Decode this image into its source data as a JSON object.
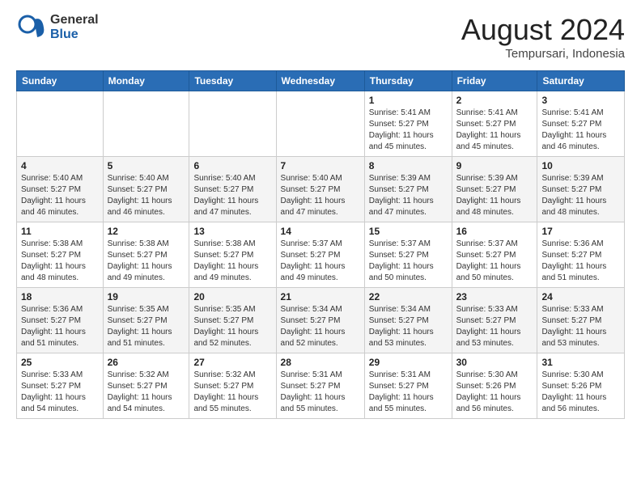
{
  "header": {
    "logo_general": "General",
    "logo_blue": "Blue",
    "month_title": "August 2024",
    "location": "Tempursari, Indonesia"
  },
  "days_of_week": [
    "Sunday",
    "Monday",
    "Tuesday",
    "Wednesday",
    "Thursday",
    "Friday",
    "Saturday"
  ],
  "weeks": [
    [
      {
        "day": "",
        "info": ""
      },
      {
        "day": "",
        "info": ""
      },
      {
        "day": "",
        "info": ""
      },
      {
        "day": "",
        "info": ""
      },
      {
        "day": "1",
        "info": "Sunrise: 5:41 AM\nSunset: 5:27 PM\nDaylight: 11 hours\nand 45 minutes."
      },
      {
        "day": "2",
        "info": "Sunrise: 5:41 AM\nSunset: 5:27 PM\nDaylight: 11 hours\nand 45 minutes."
      },
      {
        "day": "3",
        "info": "Sunrise: 5:41 AM\nSunset: 5:27 PM\nDaylight: 11 hours\nand 46 minutes."
      }
    ],
    [
      {
        "day": "4",
        "info": "Sunrise: 5:40 AM\nSunset: 5:27 PM\nDaylight: 11 hours\nand 46 minutes."
      },
      {
        "day": "5",
        "info": "Sunrise: 5:40 AM\nSunset: 5:27 PM\nDaylight: 11 hours\nand 46 minutes."
      },
      {
        "day": "6",
        "info": "Sunrise: 5:40 AM\nSunset: 5:27 PM\nDaylight: 11 hours\nand 47 minutes."
      },
      {
        "day": "7",
        "info": "Sunrise: 5:40 AM\nSunset: 5:27 PM\nDaylight: 11 hours\nand 47 minutes."
      },
      {
        "day": "8",
        "info": "Sunrise: 5:39 AM\nSunset: 5:27 PM\nDaylight: 11 hours\nand 47 minutes."
      },
      {
        "day": "9",
        "info": "Sunrise: 5:39 AM\nSunset: 5:27 PM\nDaylight: 11 hours\nand 48 minutes."
      },
      {
        "day": "10",
        "info": "Sunrise: 5:39 AM\nSunset: 5:27 PM\nDaylight: 11 hours\nand 48 minutes."
      }
    ],
    [
      {
        "day": "11",
        "info": "Sunrise: 5:38 AM\nSunset: 5:27 PM\nDaylight: 11 hours\nand 48 minutes."
      },
      {
        "day": "12",
        "info": "Sunrise: 5:38 AM\nSunset: 5:27 PM\nDaylight: 11 hours\nand 49 minutes."
      },
      {
        "day": "13",
        "info": "Sunrise: 5:38 AM\nSunset: 5:27 PM\nDaylight: 11 hours\nand 49 minutes."
      },
      {
        "day": "14",
        "info": "Sunrise: 5:37 AM\nSunset: 5:27 PM\nDaylight: 11 hours\nand 49 minutes."
      },
      {
        "day": "15",
        "info": "Sunrise: 5:37 AM\nSunset: 5:27 PM\nDaylight: 11 hours\nand 50 minutes."
      },
      {
        "day": "16",
        "info": "Sunrise: 5:37 AM\nSunset: 5:27 PM\nDaylight: 11 hours\nand 50 minutes."
      },
      {
        "day": "17",
        "info": "Sunrise: 5:36 AM\nSunset: 5:27 PM\nDaylight: 11 hours\nand 51 minutes."
      }
    ],
    [
      {
        "day": "18",
        "info": "Sunrise: 5:36 AM\nSunset: 5:27 PM\nDaylight: 11 hours\nand 51 minutes."
      },
      {
        "day": "19",
        "info": "Sunrise: 5:35 AM\nSunset: 5:27 PM\nDaylight: 11 hours\nand 51 minutes."
      },
      {
        "day": "20",
        "info": "Sunrise: 5:35 AM\nSunset: 5:27 PM\nDaylight: 11 hours\nand 52 minutes."
      },
      {
        "day": "21",
        "info": "Sunrise: 5:34 AM\nSunset: 5:27 PM\nDaylight: 11 hours\nand 52 minutes."
      },
      {
        "day": "22",
        "info": "Sunrise: 5:34 AM\nSunset: 5:27 PM\nDaylight: 11 hours\nand 53 minutes."
      },
      {
        "day": "23",
        "info": "Sunrise: 5:33 AM\nSunset: 5:27 PM\nDaylight: 11 hours\nand 53 minutes."
      },
      {
        "day": "24",
        "info": "Sunrise: 5:33 AM\nSunset: 5:27 PM\nDaylight: 11 hours\nand 53 minutes."
      }
    ],
    [
      {
        "day": "25",
        "info": "Sunrise: 5:33 AM\nSunset: 5:27 PM\nDaylight: 11 hours\nand 54 minutes."
      },
      {
        "day": "26",
        "info": "Sunrise: 5:32 AM\nSunset: 5:27 PM\nDaylight: 11 hours\nand 54 minutes."
      },
      {
        "day": "27",
        "info": "Sunrise: 5:32 AM\nSunset: 5:27 PM\nDaylight: 11 hours\nand 55 minutes."
      },
      {
        "day": "28",
        "info": "Sunrise: 5:31 AM\nSunset: 5:27 PM\nDaylight: 11 hours\nand 55 minutes."
      },
      {
        "day": "29",
        "info": "Sunrise: 5:31 AM\nSunset: 5:27 PM\nDaylight: 11 hours\nand 55 minutes."
      },
      {
        "day": "30",
        "info": "Sunrise: 5:30 AM\nSunset: 5:26 PM\nDaylight: 11 hours\nand 56 minutes."
      },
      {
        "day": "31",
        "info": "Sunrise: 5:30 AM\nSunset: 5:26 PM\nDaylight: 11 hours\nand 56 minutes."
      }
    ]
  ]
}
